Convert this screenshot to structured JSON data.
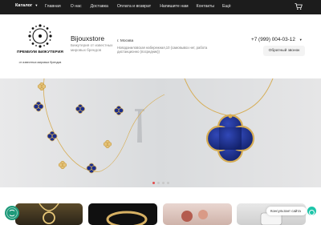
{
  "topbar": {
    "catalog_label": "Каталог",
    "nav": [
      "Главная",
      "О нас",
      "Доставка",
      "Оплата и возврат",
      "Напишите нам",
      "Контакты",
      "Ещё"
    ]
  },
  "header": {
    "logo_caption": "ПРЕМИУМ БИЖУТЕРИЯ",
    "logo_sub": "от известных мировых брендов",
    "brand": "Bijouxstore",
    "brand_desc": "Бижутерия от известных мировых брендов",
    "city": "г. Москва",
    "address": "Новоданиловская набережная,10 (самовывоз нет, работа дистанционно (посредник))",
    "phone": "+7 (999) 004-03-12",
    "callback_label": "Обратный звонок"
  },
  "slider": {
    "slide_count": 4,
    "active_index": 0
  },
  "chat": {
    "label": "Консультант сайта"
  },
  "colors": {
    "topbar": "#1c1c1c",
    "accent_dot": "#e24b4b",
    "chat": "#1ec5a9",
    "lapis": "#1a2d8c",
    "gold": "#d6ad55"
  },
  "icons": [
    "chevron-down-icon",
    "cart-icon",
    "phone-chevron-icon",
    "chat-icon",
    "contact-float-icon"
  ]
}
